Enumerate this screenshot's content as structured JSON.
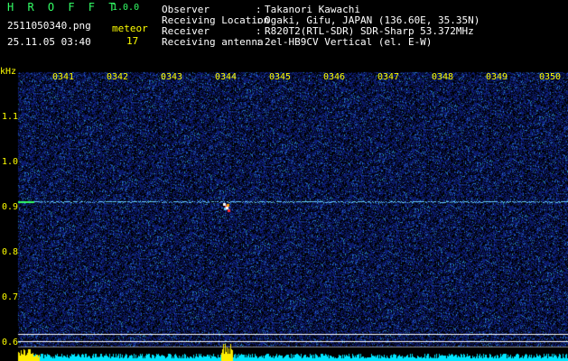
{
  "app": {
    "name": "H R O F F T",
    "version": "1.0.0"
  },
  "file": {
    "name": "2511050340.png",
    "datetime": "25.11.05 03:40"
  },
  "meteor": {
    "label": "meteor",
    "count": "17"
  },
  "info": [
    {
      "key": "Observer",
      "sep": ":",
      "value": "Takanori Kawachi"
    },
    {
      "key": "Receiving Location",
      "sep": ":",
      "value": "Ogaki, Gifu, JAPAN (136.60E, 35.35N)"
    },
    {
      "key": "Receiver",
      "sep": ":",
      "value": "R820T2(RTL-SDR) SDR-Sharp 53.372MHz"
    },
    {
      "key": "Receiving antenna",
      "sep": ":",
      "value": "2el-HB9CV Vertical (el. E-W)"
    }
  ],
  "axis": {
    "unit": "kHz",
    "time_labels": [
      "0341",
      "0342",
      "0343",
      "0344",
      "0345",
      "0346",
      "0347",
      "0348",
      "0349",
      "0350"
    ],
    "freq_labels": [
      "1.1",
      "1.0",
      "0.9",
      "0.8",
      "0.7",
      "0.6"
    ]
  },
  "colors": {
    "background": "#000000",
    "spectrum_noise": "#1a2a8a",
    "carrier": "#66ccff",
    "label_yellow": "#ffff00",
    "title_green": "#33ff66",
    "bottom_bar": "#00e5ff"
  }
}
